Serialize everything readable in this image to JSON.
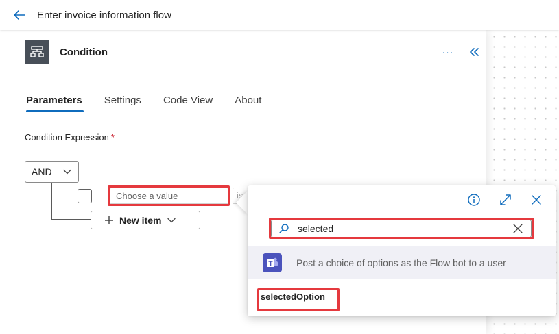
{
  "header": {
    "title": "Enter invoice information flow",
    "back_icon": "arrow-left-icon"
  },
  "action": {
    "title": "Condition",
    "icon": "condition-icon",
    "more_label": "···",
    "collapse_icon": "double-chevron-left-icon"
  },
  "tabs": [
    {
      "label": "Parameters",
      "active": true
    },
    {
      "label": "Settings",
      "active": false
    },
    {
      "label": "Code View",
      "active": false
    },
    {
      "label": "About",
      "active": false
    }
  ],
  "condition": {
    "label": "Condition Expression",
    "required_mark": "*",
    "group_operator": "AND",
    "value_placeholder": "Choose a value",
    "operator_stub": "is",
    "new_item_label": "New item"
  },
  "popover": {
    "search_value": "selected",
    "suggestion_label": "Post a choice of options as the Flow bot to a user",
    "result_label": "selectedOption",
    "icons": [
      "info-icon",
      "expand-icon",
      "close-icon"
    ]
  },
  "colors": {
    "accent": "#0f6cbd",
    "highlight": "#e5393e",
    "teams": "#4b53bc"
  }
}
